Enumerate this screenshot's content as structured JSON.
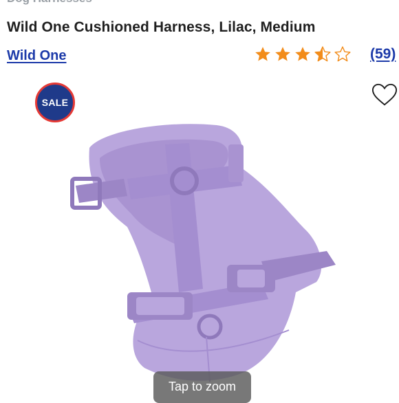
{
  "breadcrumb": "Dog Harnesses",
  "product": {
    "title": "Wild One Cushioned Harness, Lilac, Medium",
    "brand": "Wild One",
    "rating": 3.5,
    "review_count": "(59)"
  },
  "badge": {
    "label": "SALE"
  },
  "wishlist": {
    "icon": "heart-outline-icon"
  },
  "image": {
    "zoom_label": "Tap to zoom"
  },
  "colors": {
    "brand_link": "#1c3aa9",
    "star": "#f28c1a",
    "badge_bg": "#1f3a8a",
    "badge_border": "#e53935",
    "harness": "#b9a6dd"
  }
}
